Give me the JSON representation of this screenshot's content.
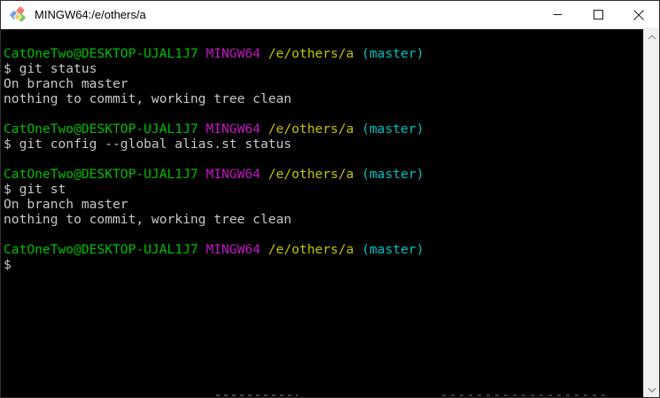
{
  "window": {
    "title": "MINGW64:/e/others/a",
    "icon": "msys2-diamonds",
    "controls": {
      "minimize": "Minimize",
      "maximize": "Maximize",
      "close": "Close"
    }
  },
  "colors": {
    "background": "#000000",
    "foreground": "#c8c8c8",
    "green": "#00be00",
    "magenta": "#c317c3",
    "yellow": "#c5c500",
    "cyan": "#00c2c2",
    "titlebar_bg": "#ffffff",
    "scrollbar_track": "#f0f0f0"
  },
  "terminal": {
    "prompt": {
      "user_host": "CatOneTwo@DESKTOP-UJAL1J7",
      "environment": "MINGW64",
      "path": "/e/others/a",
      "branch": "(master)"
    },
    "lines": [
      [],
      [
        {
          "t": "CatOneTwo@DESKTOP-UJAL1J7",
          "c": "green"
        },
        {
          "t": " ",
          "c": "fg"
        },
        {
          "t": "MINGW64",
          "c": "magenta"
        },
        {
          "t": " ",
          "c": "fg"
        },
        {
          "t": "/e/others/a",
          "c": "yellow"
        },
        {
          "t": " ",
          "c": "fg"
        },
        {
          "t": "(master)",
          "c": "cyan"
        }
      ],
      [
        {
          "t": "$ git status",
          "c": "fg"
        }
      ],
      [
        {
          "t": "On branch master",
          "c": "fg"
        }
      ],
      [
        {
          "t": "nothing to commit, working tree clean",
          "c": "fg"
        }
      ],
      [],
      [
        {
          "t": "CatOneTwo@DESKTOP-UJAL1J7",
          "c": "green"
        },
        {
          "t": " ",
          "c": "fg"
        },
        {
          "t": "MINGW64",
          "c": "magenta"
        },
        {
          "t": " ",
          "c": "fg"
        },
        {
          "t": "/e/others/a",
          "c": "yellow"
        },
        {
          "t": " ",
          "c": "fg"
        },
        {
          "t": "(master)",
          "c": "cyan"
        }
      ],
      [
        {
          "t": "$ git config --global alias.st status",
          "c": "fg"
        }
      ],
      [],
      [
        {
          "t": "CatOneTwo@DESKTOP-UJAL1J7",
          "c": "green"
        },
        {
          "t": " ",
          "c": "fg"
        },
        {
          "t": "MINGW64",
          "c": "magenta"
        },
        {
          "t": " ",
          "c": "fg"
        },
        {
          "t": "/e/others/a",
          "c": "yellow"
        },
        {
          "t": " ",
          "c": "fg"
        },
        {
          "t": "(master)",
          "c": "cyan"
        }
      ],
      [
        {
          "t": "$ git st",
          "c": "fg"
        }
      ],
      [
        {
          "t": "On branch master",
          "c": "fg"
        }
      ],
      [
        {
          "t": "nothing to commit, working tree clean",
          "c": "fg"
        }
      ],
      [],
      [
        {
          "t": "CatOneTwo@DESKTOP-UJAL1J7",
          "c": "green"
        },
        {
          "t": " ",
          "c": "fg"
        },
        {
          "t": "MINGW64",
          "c": "magenta"
        },
        {
          "t": " ",
          "c": "fg"
        },
        {
          "t": "/e/others/a",
          "c": "yellow"
        },
        {
          "t": " ",
          "c": "fg"
        },
        {
          "t": "(master)",
          "c": "cyan"
        }
      ],
      [
        {
          "t": "$",
          "c": "fg"
        }
      ]
    ]
  }
}
